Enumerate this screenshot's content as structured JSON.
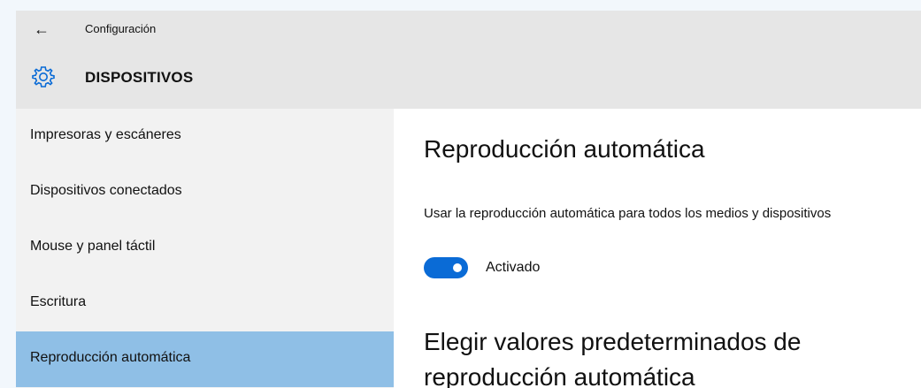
{
  "window": {
    "back_icon": "back-arrow-icon",
    "title": "Configuración"
  },
  "header": {
    "icon": "gear-icon",
    "section_title": "DISPOSITIVOS"
  },
  "sidebar": {
    "selected_index": 4,
    "items": [
      {
        "label": "Impresoras y escáneres"
      },
      {
        "label": "Dispositivos conectados"
      },
      {
        "label": "Mouse y panel táctil"
      },
      {
        "label": "Escritura"
      },
      {
        "label": "Reproducción automática"
      }
    ]
  },
  "main": {
    "heading": "Reproducción automática",
    "autoplay_description": "Usar la reproducción automática para todos los medios y dispositivos",
    "toggle": {
      "state": "on",
      "label": "Activado",
      "color": "#0a6bd6"
    },
    "defaults_heading": "Elegir valores predeterminados de reproducción automática"
  },
  "colors": {
    "header_bg": "#e6e6e6",
    "sidebar_bg": "#f2f2f2",
    "selected_bg": "#8fbfe6",
    "accent": "#0a6bd6"
  }
}
